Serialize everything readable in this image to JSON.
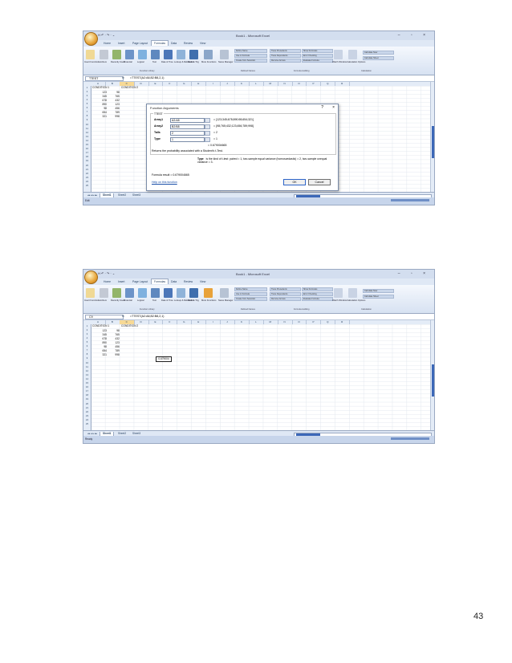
{
  "page_number": "43",
  "ribbon": {
    "tabs": [
      "Home",
      "Insert",
      "Page Layout",
      "Formulas",
      "Data",
      "Review",
      "View"
    ],
    "active_tab": "Formulas",
    "buttons": [
      "Insert Function",
      "AutoSum",
      "Recently Used",
      "Financial",
      "Logical",
      "Text",
      "Date & Time",
      "Lookup & Reference",
      "Math & Trig",
      "More Functions",
      "Name Manager"
    ],
    "small_items": [
      "Define Name",
      "Use in Formula",
      "Create from Selection",
      "Trace Precedents",
      "Trace Dependents",
      "Remove Arrows",
      "Show Formulas",
      "Error Checking",
      "Evaluate Formula",
      "Watch Window",
      "Calculation Options",
      "Calculate Now",
      "Calculate Sheet"
    ],
    "groups": [
      "Function Library",
      "Defined Names",
      "Formula Auditing",
      "Calculation"
    ]
  },
  "window": {
    "title": "Book1 - Microsoft Excel",
    "qat": "H  ↶ · ↷ · ⌄",
    "controls": "– ▫ ×"
  },
  "columns": [
    "A",
    "B",
    "C",
    "D",
    "E",
    "F",
    "G",
    "H",
    "I",
    "J",
    "K",
    "L",
    "M",
    "N",
    "O",
    "P",
    "Q",
    "R"
  ],
  "rows": [
    "1",
    "2",
    "3",
    "4",
    "5",
    "6",
    "7",
    "8",
    "9",
    "10",
    "11",
    "12",
    "13",
    "14",
    "15",
    "16",
    "17",
    "18",
    "19",
    "20",
    "21",
    "22",
    "23",
    "24",
    "25"
  ],
  "headers": {
    "a1": "CONDITION 1",
    "b1": "CONDITION 2"
  },
  "data_a": [
    "123",
    "345",
    "678",
    "890",
    "98",
    "654",
    "321"
  ],
  "data_b": [
    "98",
    "765",
    "432",
    "123",
    "456",
    "789",
    "998"
  ],
  "sheets": [
    "Sheet1",
    "Sheet2",
    "Sheet3"
  ],
  "shot1": {
    "namebox": "TTEST",
    "formula": "=TTEST(A2:A8,B2:B8,2,1)",
    "status": "Edit"
  },
  "shot2": {
    "namebox": "C9",
    "formula": "=TTEST(A2:A8,B2:B8,2,1)",
    "selected_value": "0.679004",
    "status": "Ready"
  },
  "dialog": {
    "title": "Function Arguments",
    "function_name": "TTEST",
    "args": [
      {
        "label": "Array1",
        "input": "A2:A8",
        "value": "= {123;345;678;890;98;654;321}"
      },
      {
        "label": "Array2",
        "input": "B2:B8",
        "value": "= {98;765;432;123;456;789;998}"
      },
      {
        "label": "Tails",
        "input": "2",
        "value": "= 2"
      },
      {
        "label": "Type",
        "input": "1",
        "value": "= 1"
      }
    ],
    "result_line": "= 0.679004665",
    "description": "Returns the probability associated with a Student's t-Test.",
    "type_label": "Type",
    "type_help": "is the kind of t-test: paired = 1, two-sample equal variance (homoscedastic) = 2, two-sample unequal variance = 3.",
    "formula_result": "Formula result = 0.679004665",
    "help_link": "Help on this function",
    "ok": "OK",
    "cancel": "Cancel",
    "help_glyph": "?",
    "close_glyph": "×"
  }
}
